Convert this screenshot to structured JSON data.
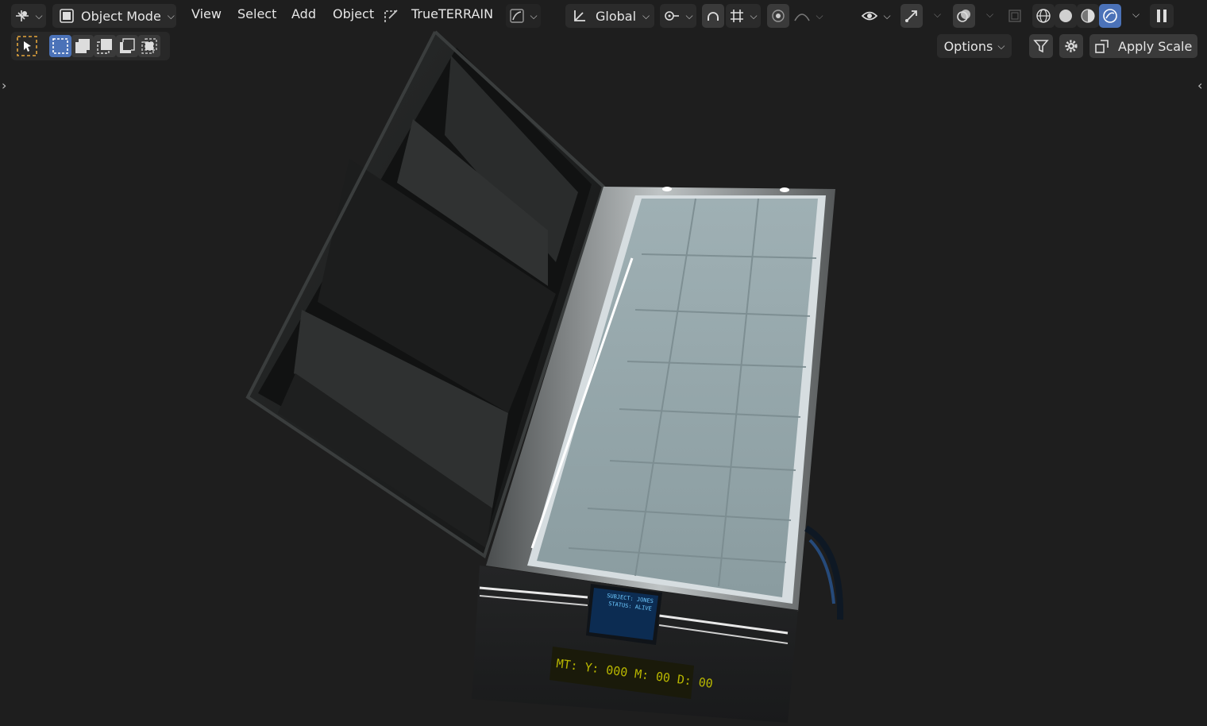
{
  "header": {
    "mode_label": "Object Mode",
    "menus": [
      "View",
      "Select",
      "Add",
      "Object"
    ],
    "addon_label": "TrueTERRAIN",
    "transform_orientation": "Global"
  },
  "toolbar": {
    "options_label": "Options",
    "apply_scale_label": "Apply Scale"
  },
  "scene": {
    "screen_title": "SUBJECT: JONES",
    "screen_status": "STATUS: ALIVE",
    "timer_text": "MT: Y: 000 M: 00 D: 00"
  },
  "colors": {
    "header_bg": "#2b2b2b",
    "accent": "#4b72b8",
    "viewport_bg": "#1e1e1e",
    "select_box": "#e2a43c",
    "timer_text": "#b9b700",
    "screen_text": "#6cc8ff"
  },
  "icons": [
    "editor-type-icon",
    "object-mode-icon",
    "trueterrain-icon",
    "transform-icon",
    "pivot-icon",
    "snap-icon",
    "proportional-icon",
    "visibility-icon",
    "gizmo-icon",
    "overlay-icon",
    "xray-icon",
    "wireframe-icon",
    "solid-icon",
    "material-icon",
    "rendered-icon",
    "pause-icon",
    "select-tool-icon",
    "filter-icon",
    "gear-icon",
    "apply-scale-icon"
  ]
}
